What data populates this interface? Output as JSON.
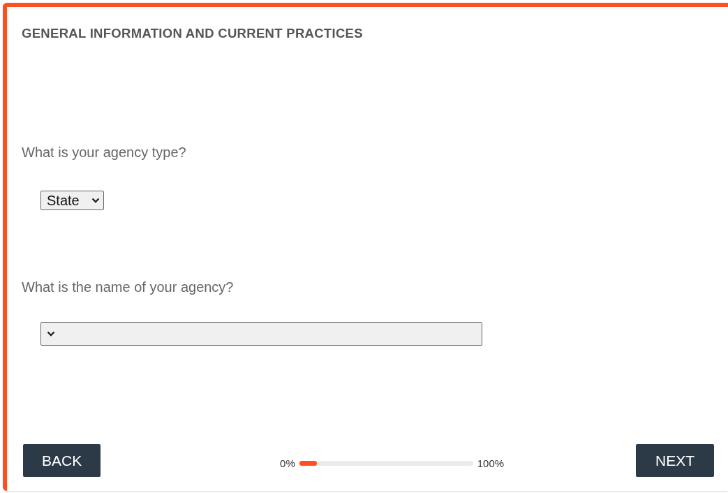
{
  "title": "GENERAL INFORMATION AND CURRENT PRACTICES",
  "questions": [
    {
      "label": "What is your agency type?",
      "kind": "short",
      "value": "State"
    },
    {
      "label": "What is the name of your agency?",
      "kind": "wide"
    }
  ],
  "navigation": {
    "back": "BACK",
    "next": "NEXT"
  },
  "progress": {
    "start": "0%",
    "end": "100%",
    "level": 0.1
  }
}
